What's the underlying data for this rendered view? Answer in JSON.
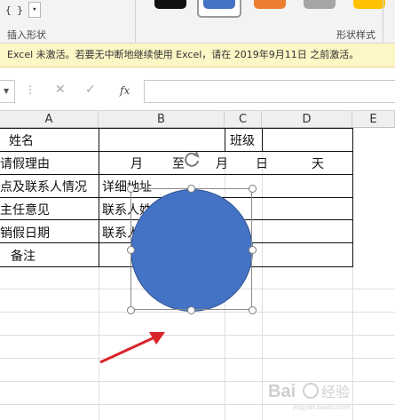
{
  "ribbon": {
    "shape_braces": "{ }",
    "shape_dropdown_glyph": "▾",
    "insert_shape_label": "插入形状",
    "shape_styles_label": "形状样式",
    "swatch_colors": [
      "#111111",
      "#4472c4",
      "#ed7d31",
      "#a5a5a5",
      "#ffc000"
    ]
  },
  "warning": {
    "text": "Excel 未激活。若要无中断地继续使用 Excel，请在 2019年9月11日 之前激活。"
  },
  "formula_bar": {
    "cancel_glyph": "✕",
    "enter_glyph": "✓",
    "fx_label": "fx",
    "value": ""
  },
  "columns": [
    "A",
    "B",
    "C",
    "D",
    "E"
  ],
  "sheet": {
    "a1": "姓名",
    "c1": "班级",
    "a2": "请假理由",
    "b2_month": "月",
    "b2_to": "至",
    "c2_month": "月",
    "c2_day": "日",
    "d2_days": "天",
    "a3": "点及联系人情况",
    "b3": "详细地址",
    "a4": "主任意见",
    "b4": "联系人姓",
    "a5": "销假日期",
    "b5": "联系人",
    "a6": "备注"
  },
  "shape": {
    "fill_color": "#4472c4",
    "type": "oval"
  },
  "annotation": {
    "arrow_color": "#d9232a"
  },
  "watermark": {
    "text": "Bai 经验",
    "sub": "jingyan.baidu.com"
  }
}
